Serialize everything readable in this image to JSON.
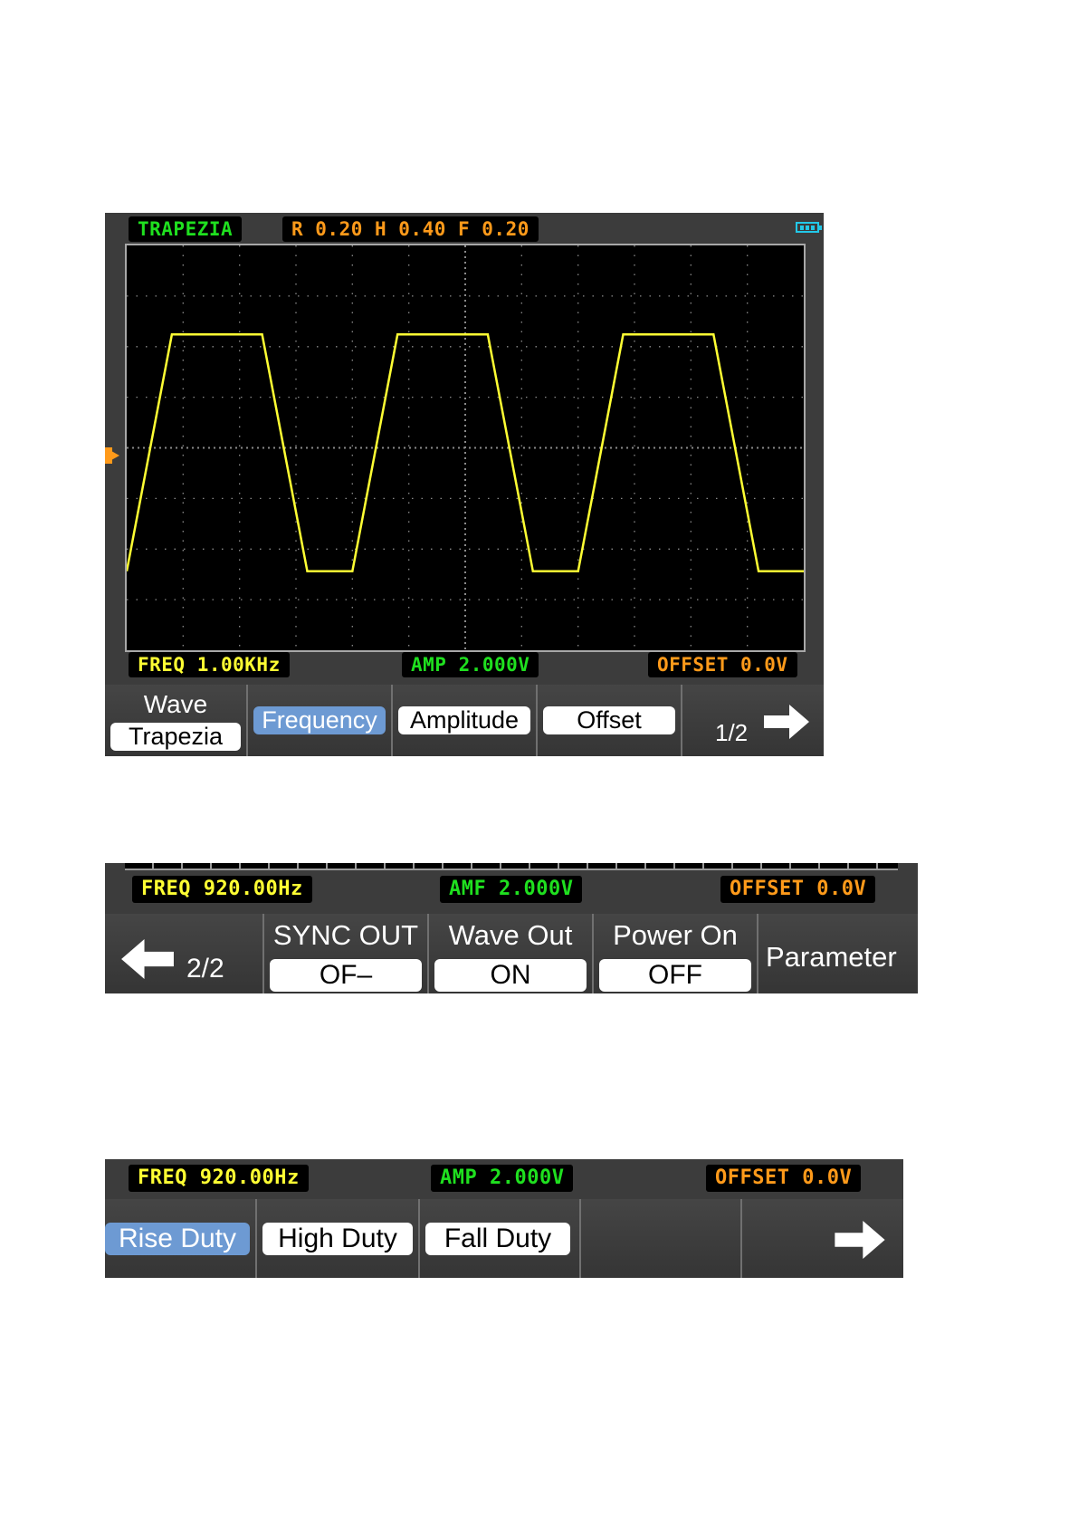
{
  "screen1": {
    "wave_name": "TRAPEZIA",
    "params": "R 0.20   H 0.40   F 0.20",
    "freq": "FREQ 1.00KHz",
    "amp": "AMP 2.000V",
    "offset": "OFFSET 0.0V",
    "menu": {
      "wave_label": "Wave",
      "wave_value": "Trapezia",
      "frequency": "Frequency",
      "amplitude": "Amplitude",
      "offset": "Offset",
      "page": "1/2"
    },
    "waveform": {
      "type": "trapezoid",
      "cycles": 3,
      "rise": 0.2,
      "high": 0.4,
      "fall": 0.2,
      "color": "#ffff33"
    }
  },
  "screen2": {
    "freq": "FREQ 920.00Hz",
    "amp": "AMF 2.000V",
    "offset": "OFFSET 0.0V",
    "menu": {
      "page": "2/2",
      "sync_label": "SYNC OUT",
      "sync_value": "OF–",
      "waveout_label": "Wave Out",
      "waveout_value": "ON",
      "poweron_label": "Power On",
      "poweron_value": "OFF",
      "parameter": "Parameter"
    }
  },
  "screen3": {
    "freq": "FREQ 920.00Hz",
    "amp": "AMP 2.000V",
    "offset": "OFFSET 0.0V",
    "menu": {
      "rise": "Rise Duty",
      "high": "High Duty",
      "fall": "Fall Duty"
    }
  },
  "colors": {
    "accent_selected": "#6d9ad3",
    "green": "#1fe01f",
    "orange": "#ff9a1a",
    "trace": "#ffff33"
  }
}
